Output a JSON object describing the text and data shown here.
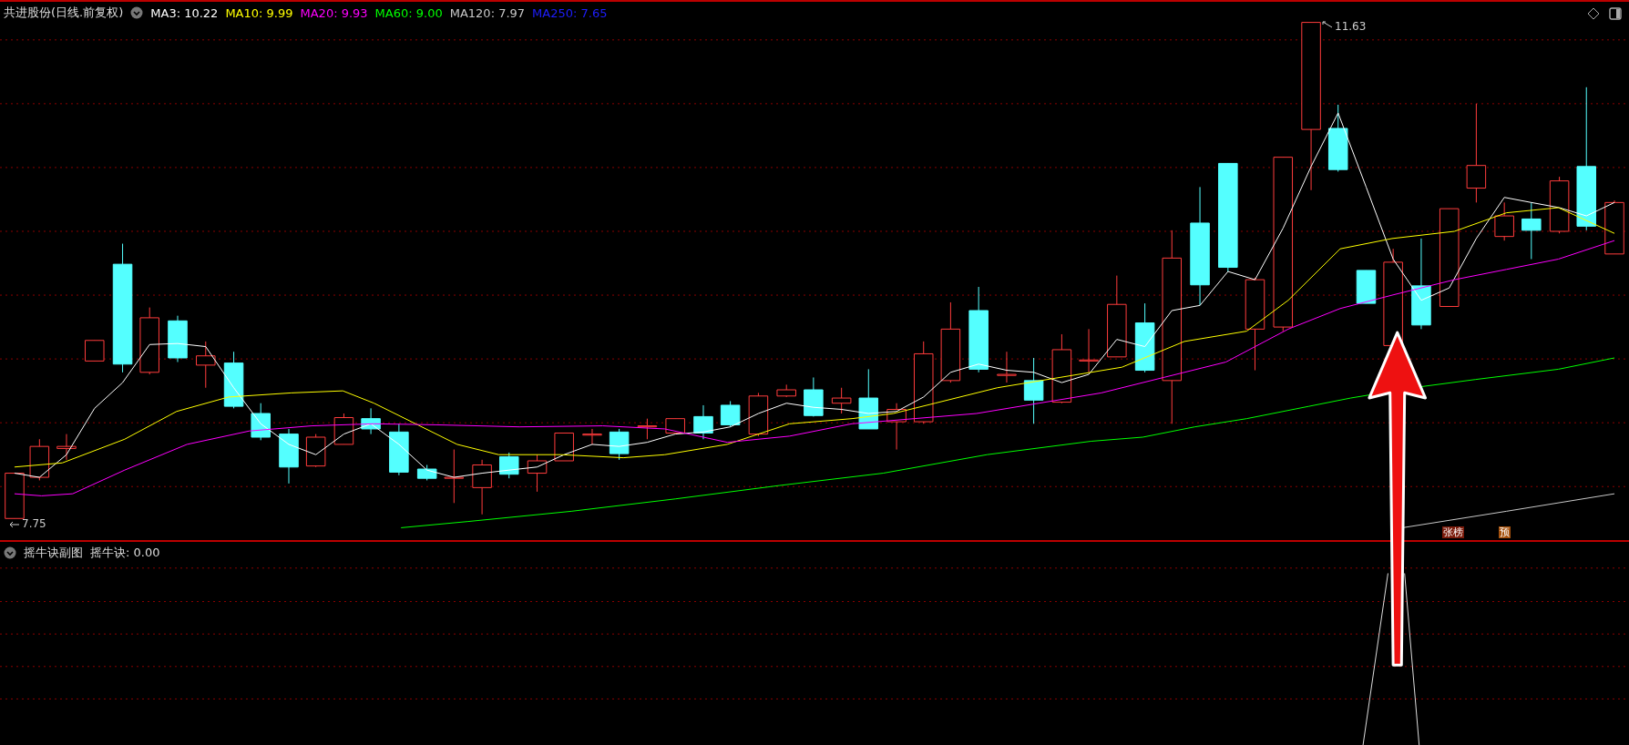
{
  "header": {
    "title": "共进股份(日线.前复权)",
    "indicators": [
      {
        "label": "MA3: 10.22",
        "color": "#ffffff"
      },
      {
        "label": "MA10: 9.99",
        "color": "#ffff00"
      },
      {
        "label": "MA20: 9.93",
        "color": "#ff00ff"
      },
      {
        "label": "MA60: 9.00",
        "color": "#00ff00"
      },
      {
        "label": "MA120: 7.97",
        "color": "#c8c8c8"
      },
      {
        "label": "MA250: 7.65",
        "color": "#1e1eff"
      }
    ]
  },
  "price_chart": {
    "high_label": "11.63",
    "low_label": "7.75",
    "tags": [
      {
        "label": "张榜",
        "color": "#7a1a0a"
      },
      {
        "label": "预",
        "color": "#a4500c"
      }
    ]
  },
  "sub_panel": {
    "title": "摇牛诀副图",
    "indicator": "摇牛诀: 0.00"
  }
}
